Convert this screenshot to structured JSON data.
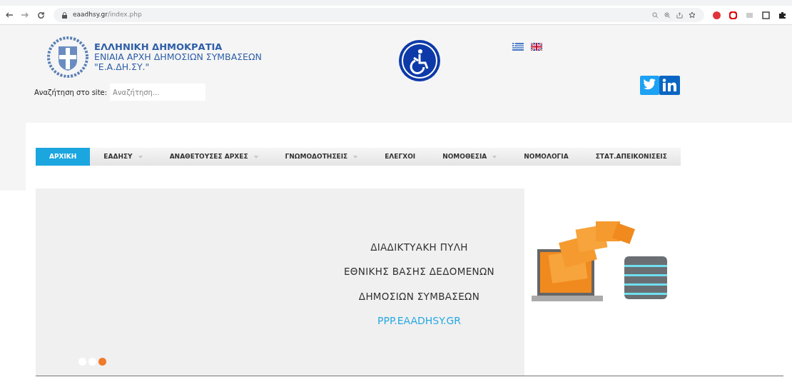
{
  "browser": {
    "url_host": "eaadhsy.gr",
    "url_path": "/index.php"
  },
  "header": {
    "title": "ΕΛΛΗΝΙΚΗ ΔΗΜΟΚΡΑΤΙΑ",
    "subtitle": "ΕΝΙΑΙΑ ΑΡΧΗ ΔΗΜΟΣΙΩΝ ΣΥΜΒΑΣΕΩΝ",
    "abbr": "\"Ε.Α.ΔΗ.ΣΥ.\"",
    "search_label": "Αναζήτηση στο site:",
    "search_placeholder": "Αναζήτηση..."
  },
  "nav": [
    {
      "label": "ΑΡΧΙΚΗ",
      "selected": true,
      "dropdown": false
    },
    {
      "label": "ΕΑΔΗΣΥ",
      "selected": false,
      "dropdown": true
    },
    {
      "label": "ΑΝΑΘΕΤΟΥΣΕΣ ΑΡΧΕΣ",
      "selected": false,
      "dropdown": true
    },
    {
      "label": "ΓΝΩΜΟΔΟΤΗΣΕΙΣ",
      "selected": false,
      "dropdown": true
    },
    {
      "label": "ΕΛΕΓΧΟΙ",
      "selected": false,
      "dropdown": false
    },
    {
      "label": "ΝΟΜΟΘΕΣΙΑ",
      "selected": false,
      "dropdown": true
    },
    {
      "label": "ΝΟΜΟΛΟΓΙΑ",
      "selected": false,
      "dropdown": false
    },
    {
      "label": "ΣΤΑΤ.ΑΠΕΙΚΟΝΙΣΕΙΣ",
      "selected": false,
      "dropdown": false
    }
  ],
  "slide": {
    "lines": [
      "ΔΙΑΔΙΚΤΥΑΚΗ ΠΥΛΗ",
      "ΕΘΝΙΚΗΣ ΒΑΣΗΣ ΔΕΔΟΜΕΝΩΝ",
      "ΔΗΜΟΣΙΩΝ ΣΥΜΒΑΣΕΩΝ"
    ],
    "link": "PPP.EAADHSY.GR",
    "dots": [
      {
        "selected": false
      },
      {
        "selected": false
      },
      {
        "selected": true
      }
    ]
  }
}
